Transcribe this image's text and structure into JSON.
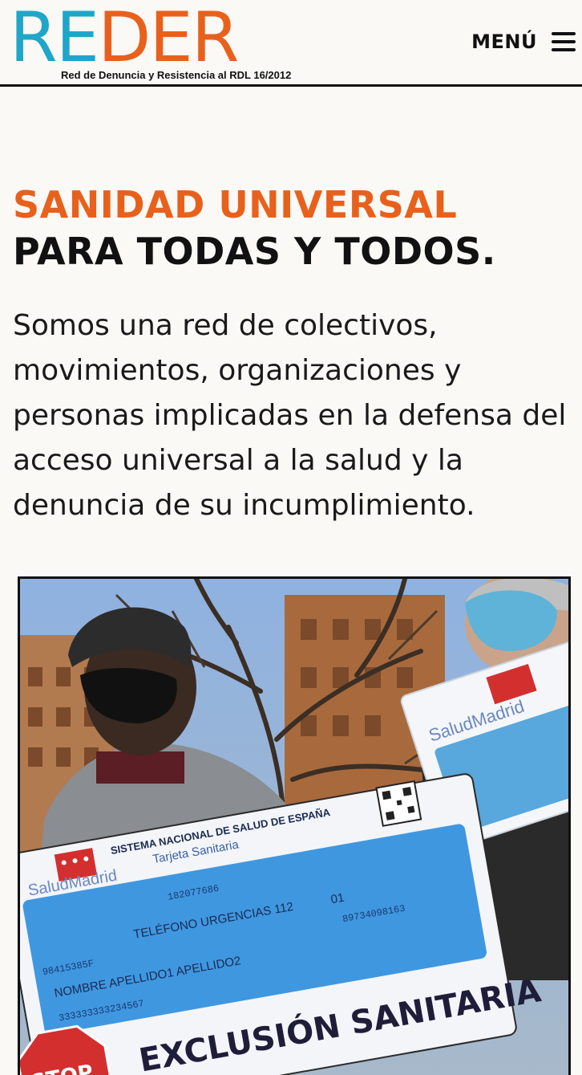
{
  "header": {
    "logo": {
      "letters": [
        "R",
        "E",
        "D",
        "E",
        "R"
      ],
      "tagline": "Red de Denuncia y Resistencia al RDL 16/2012"
    },
    "menu_label": "MENÚ",
    "menu_icon": "hamburger-icon"
  },
  "hero": {
    "headline_accent": "SANIDAD UNIVERSAL",
    "headline_main": "PARA TODAS Y TODOS.",
    "intro": "Somos una red de colectivos, movimientos, organizaciones y personas implicadas en la defensa del acceso universal a la salud y la denuncia de su incumplimiento."
  },
  "photo": {
    "card": {
      "system": "SISTEMA NACIONAL DE SALUD DE ESPAÑA",
      "type": "Tarjeta Sanitaria",
      "brand": "SaludMadrid",
      "phone": "TELÉFONO URGENCIAS 112",
      "code_1": "01",
      "name": "NOMBRE APELLIDO1 APELLIDO2",
      "id_a": "182077686",
      "id_b": "98415385F",
      "id_c": "89734098163",
      "id_d": "333333333234567"
    },
    "banner": "EXCLUSIÓN SANITARIA",
    "stop": "STOP",
    "second_card_brand": "SaludMadrid"
  },
  "colors": {
    "accent": "#e8611c",
    "logo_blue": "#1fa6c9",
    "text": "#111111",
    "background": "#faf9f6"
  }
}
